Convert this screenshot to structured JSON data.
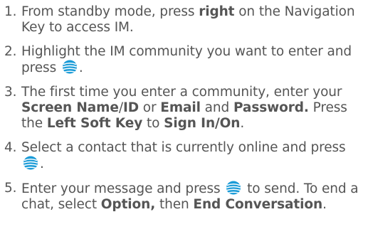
{
  "steps": [
    {
      "num": "1.",
      "parts": [
        "From standby mode, press ",
        "right",
        " on the Navigation Key to access IM."
      ]
    },
    {
      "num": "2.",
      "parts": [
        "Highlight the IM community you want to enter and press ",
        "."
      ]
    },
    {
      "num": "3.",
      "parts": [
        "The first time you enter a community, enter your ",
        "Screen Name",
        "/",
        "ID",
        " or ",
        "Email",
        " and ",
        "Password.",
        " Press the ",
        "Left Soft Key",
        " to ",
        "Sign In/On",
        "."
      ]
    },
    {
      "num": "4.",
      "parts": [
        "Select a contact that is currently online and press ",
        "."
      ]
    },
    {
      "num": "5.",
      "parts": [
        "Enter your message and press ",
        " to send. To end a chat, select ",
        "Option,",
        " then ",
        "End Conversation",
        "."
      ]
    }
  ],
  "icon": "att-globe-icon",
  "colors": {
    "text": "#555555",
    "icon_blue": "#1a9bd7"
  }
}
